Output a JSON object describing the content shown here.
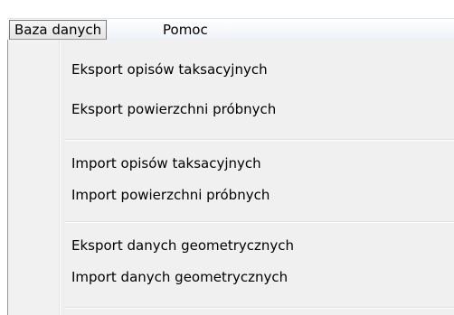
{
  "menubar": {
    "items": [
      {
        "label": "Baza danych"
      },
      {
        "label": "Pomoc"
      }
    ]
  },
  "dropdown": {
    "items": [
      {
        "label": "Eksport opisów taksacyjnych"
      },
      {
        "label": "Eksport powierzchni próbnych"
      },
      {
        "label": "Import opisów taksacyjnych"
      },
      {
        "label": "Import powierzchni próbnych"
      },
      {
        "label": "Eksport danych geometrycznych"
      },
      {
        "label": "Import danych geometrycznych"
      }
    ]
  }
}
